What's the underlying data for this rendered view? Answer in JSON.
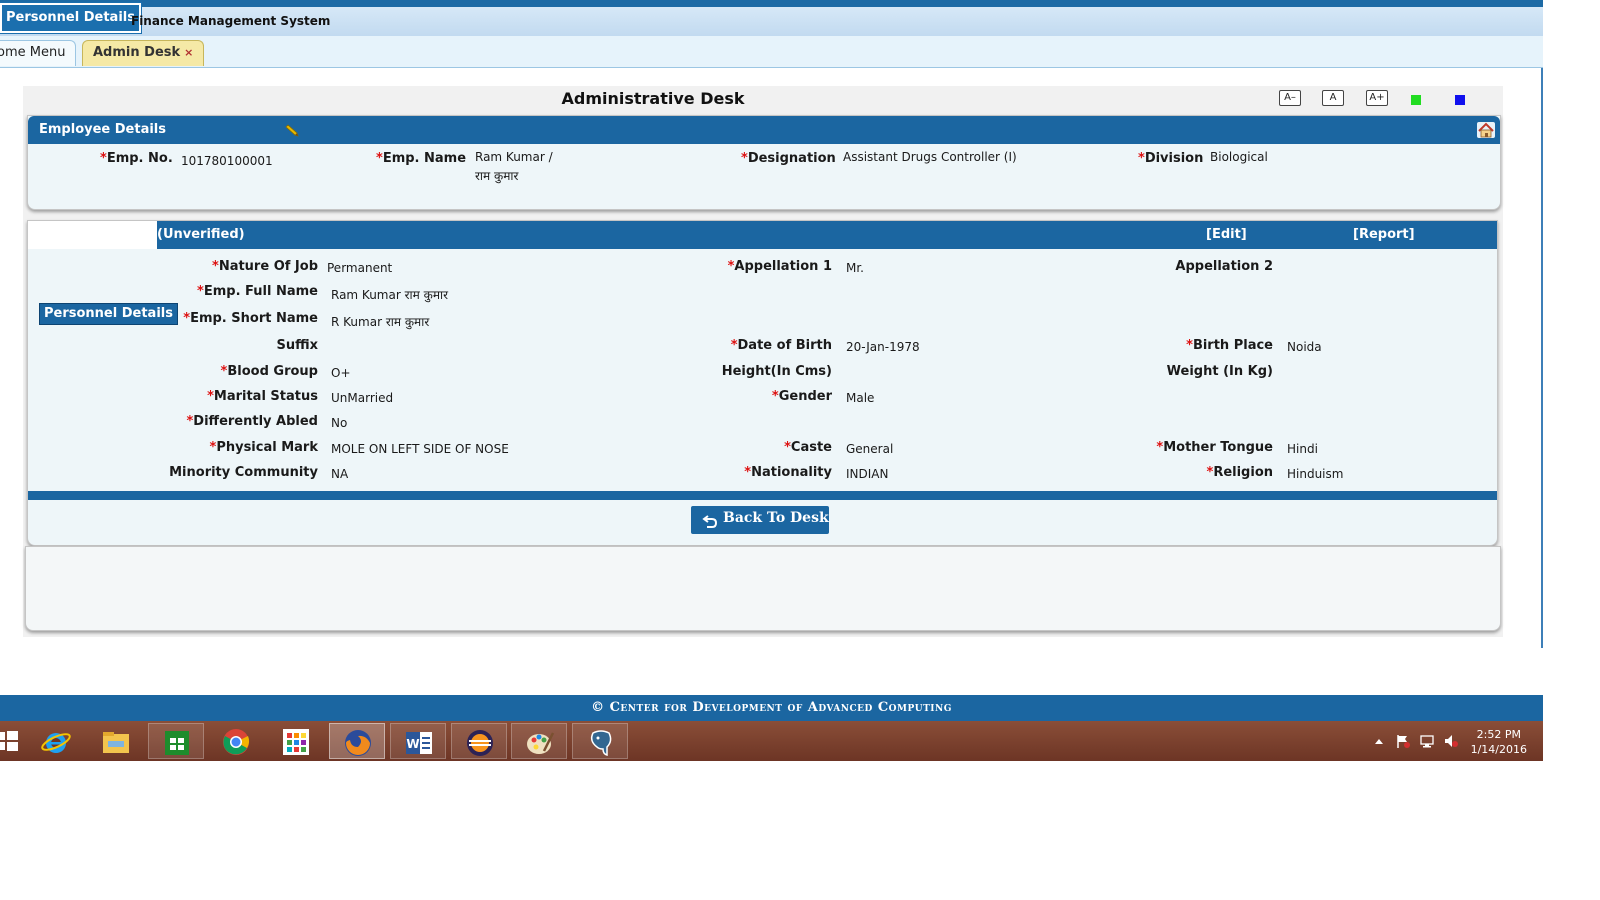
{
  "app": {
    "badge": "Personnel Details",
    "title": "Finance Management System"
  },
  "tabs": [
    {
      "label": "ome Menu"
    },
    {
      "label": "Admin Desk",
      "close": "×"
    }
  ],
  "desk": {
    "title": "Administrative Desk",
    "font_controls": [
      "A–",
      "A",
      "A+"
    ],
    "theme_colors": [
      "#22dd22",
      "#1010ee"
    ]
  },
  "employee": {
    "header": "Employee Details",
    "emp_no_label": "Emp. No.",
    "emp_no": "101780100001",
    "emp_name_label": "Emp. Name",
    "emp_name_line1": "Ram Kumar /",
    "emp_name_line2": "राम कुमार",
    "designation_label": "Designation",
    "designation": "Assistant Drugs Controller (I)",
    "division_label": "Division",
    "division": "Biological"
  },
  "personnel": {
    "status": "(Unverified)",
    "edit": "[Edit]",
    "report": "[Report]",
    "side_button": "Personnel Details",
    "fields": {
      "nature_of_job": {
        "label": "Nature Of Job",
        "value": "Permanent"
      },
      "appellation1": {
        "label": "Appellation 1",
        "value": "Mr."
      },
      "appellation2": {
        "label": "Appellation 2",
        "value": ""
      },
      "full_name": {
        "label": "Emp. Full Name",
        "value": "Ram Kumar  राम कुमार"
      },
      "short_name": {
        "label": "Emp. Short Name",
        "value": "R Kumar  राम कुमार"
      },
      "suffix": {
        "label": "Suffix",
        "value": ""
      },
      "dob": {
        "label": "Date of Birth",
        "value": "20-Jan-1978"
      },
      "birth_place": {
        "label": "Birth Place",
        "value": "Noida"
      },
      "blood_group": {
        "label": "Blood Group",
        "value": "O+"
      },
      "height": {
        "label": "Height(In Cms)",
        "value": ""
      },
      "weight": {
        "label": "Weight (In Kg)",
        "value": ""
      },
      "marital_status": {
        "label": "Marital Status",
        "value": "UnMarried"
      },
      "gender": {
        "label": "Gender",
        "value": "Male"
      },
      "differently_abled": {
        "label": "Differently Abled",
        "value": "No"
      },
      "physical_mark": {
        "label": "Physical Mark",
        "value": "MOLE ON LEFT SIDE OF NOSE"
      },
      "caste": {
        "label": "Caste",
        "value": "General"
      },
      "mother_tongue": {
        "label": "Mother Tongue",
        "value": "Hindi"
      },
      "minority": {
        "label": "Minority Community",
        "value": "NA"
      },
      "nationality": {
        "label": "Nationality",
        "value": "INDIAN"
      },
      "religion": {
        "label": "Religion",
        "value": "Hinduism"
      }
    },
    "back_button": "Back To Desk"
  },
  "footer": {
    "text": "© Center for Development of Advanced Computing"
  },
  "taskbar": {
    "items": [
      "start-icon",
      "internet-explorer-icon",
      "file-explorer-icon",
      "store-icon",
      "chrome-icon",
      "apps-icon",
      "firefox-icon",
      "word-icon",
      "eclipse-icon",
      "paint-icon",
      "postgresql-icon"
    ],
    "time": "2:52 PM",
    "date": "1/14/2016"
  }
}
